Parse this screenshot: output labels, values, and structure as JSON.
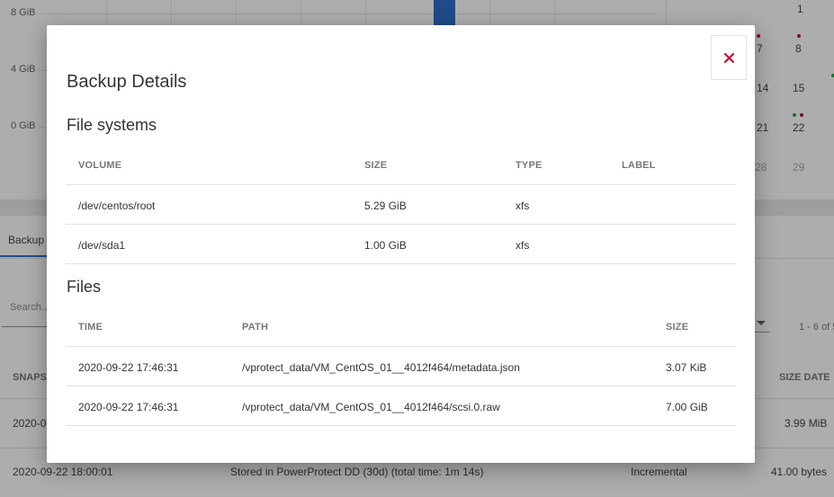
{
  "background": {
    "chart": {
      "y_ticks": [
        "8 GiB",
        "4 GiB",
        "0 GiB"
      ]
    },
    "calendar": {
      "numbers": [
        "1",
        "7",
        "8",
        "14",
        "15",
        "21",
        "22",
        "28",
        "29"
      ]
    },
    "tab_label": "Backup",
    "search_placeholder": "Search...",
    "pager": "1 - 6 of 5",
    "table": {
      "headers": [
        "SNAPS",
        "SIZE DATE"
      ],
      "rows": [
        {
          "time": "2020-0",
          "status": "",
          "type": "",
          "size": "3.99 MiB"
        },
        {
          "time": "2020-09-22 18:00:01",
          "status": "Stored in PowerProtect DD (30d) (total time: 1m 14s)",
          "type": "Incremental",
          "size": "41.00 bytes"
        }
      ]
    }
  },
  "modal": {
    "title": "Backup Details",
    "close_icon": "close-icon",
    "file_systems": {
      "title": "File systems",
      "headers": {
        "volume": "VOLUME",
        "size": "SIZE",
        "type": "TYPE",
        "label": "LABEL"
      },
      "rows": [
        {
          "volume": "/dev/centos/root",
          "size": "5.29 GiB",
          "type": "xfs",
          "label": ""
        },
        {
          "volume": "/dev/sda1",
          "size": "1.00 GiB",
          "type": "xfs",
          "label": ""
        }
      ]
    },
    "files": {
      "title": "Files",
      "headers": {
        "time": "TIME",
        "path": "PATH",
        "size": "SIZE"
      },
      "rows": [
        {
          "time": "2020-09-22 17:46:31",
          "path": "/vprotect_data/VM_CentOS_01__4012f464/metadata.json",
          "size": "3.07 KiB"
        },
        {
          "time": "2020-09-22 17:46:31",
          "path": "/vprotect_data/VM_CentOS_01__4012f464/scsi.0.raw",
          "size": "7.00 GiB"
        }
      ]
    }
  },
  "colors": {
    "accent": "#2f6fc9",
    "close_icon": "#c8102e",
    "dot_red": "#c8102e",
    "dot_green": "#2e9e4f"
  }
}
